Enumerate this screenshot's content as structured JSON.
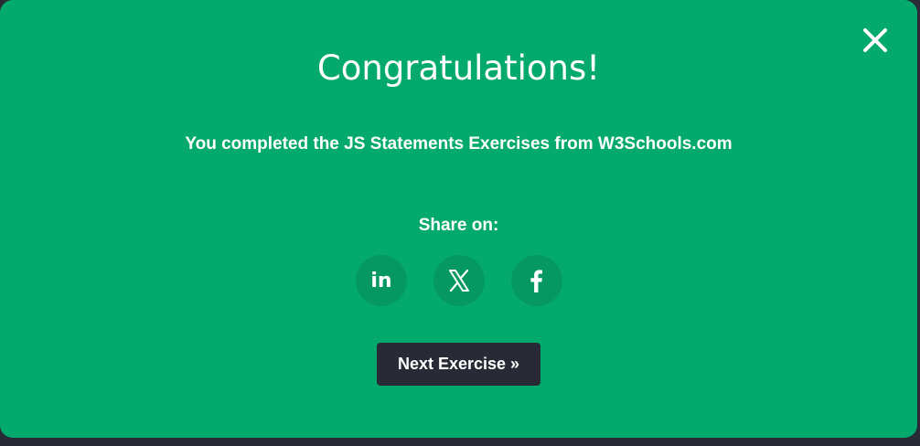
{
  "modal": {
    "title": "Congratulations!",
    "subtitle": "You completed the JS Statements Exercises from W3Schools.com",
    "share_label": "Share on:",
    "share_buttons": [
      {
        "icon": "linkedin-icon",
        "glyph": "in"
      },
      {
        "icon": "x-icon"
      },
      {
        "icon": "facebook-icon"
      }
    ],
    "next_label": "Next Exercise »",
    "close_icon": "close-icon"
  },
  "colors": {
    "modal_background": "#04aa6d",
    "share_button_background": "#059862",
    "next_button_background": "#282a35",
    "page_background": "#282a35",
    "text": "#ffffff"
  }
}
